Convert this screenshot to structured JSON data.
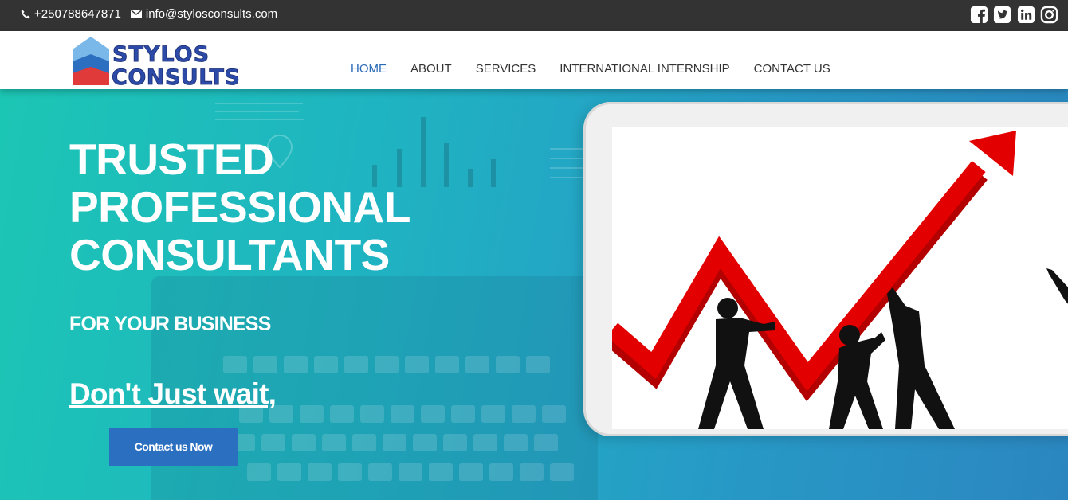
{
  "topbar": {
    "phone": "+250788647871",
    "email": "info@stylosconsults.com",
    "social": [
      "facebook-icon",
      "twitter-icon",
      "linkedin-icon",
      "instagram-icon"
    ]
  },
  "logo": {
    "line1": "STYLOS",
    "line2": "CONSULTS"
  },
  "nav": {
    "items": [
      "HOME",
      "ABOUT",
      "SERVICES",
      "INTERNATIONAL INTERNSHIP",
      "CONTACT US"
    ],
    "active": "HOME"
  },
  "hero": {
    "title_line1": "TRUSTED",
    "title_line2": "PROFESSIONAL",
    "title_line3": "CONSULTANTS",
    "subtitle": "FOR YOUR BUSINESS",
    "tagline": "Don't Just wait,",
    "cta_label": "Contact us Now"
  },
  "colors": {
    "topbar_bg": "#333333",
    "accent": "#2a6ab5",
    "button": "#2a6fc0",
    "arrow_red": "#e00000"
  }
}
